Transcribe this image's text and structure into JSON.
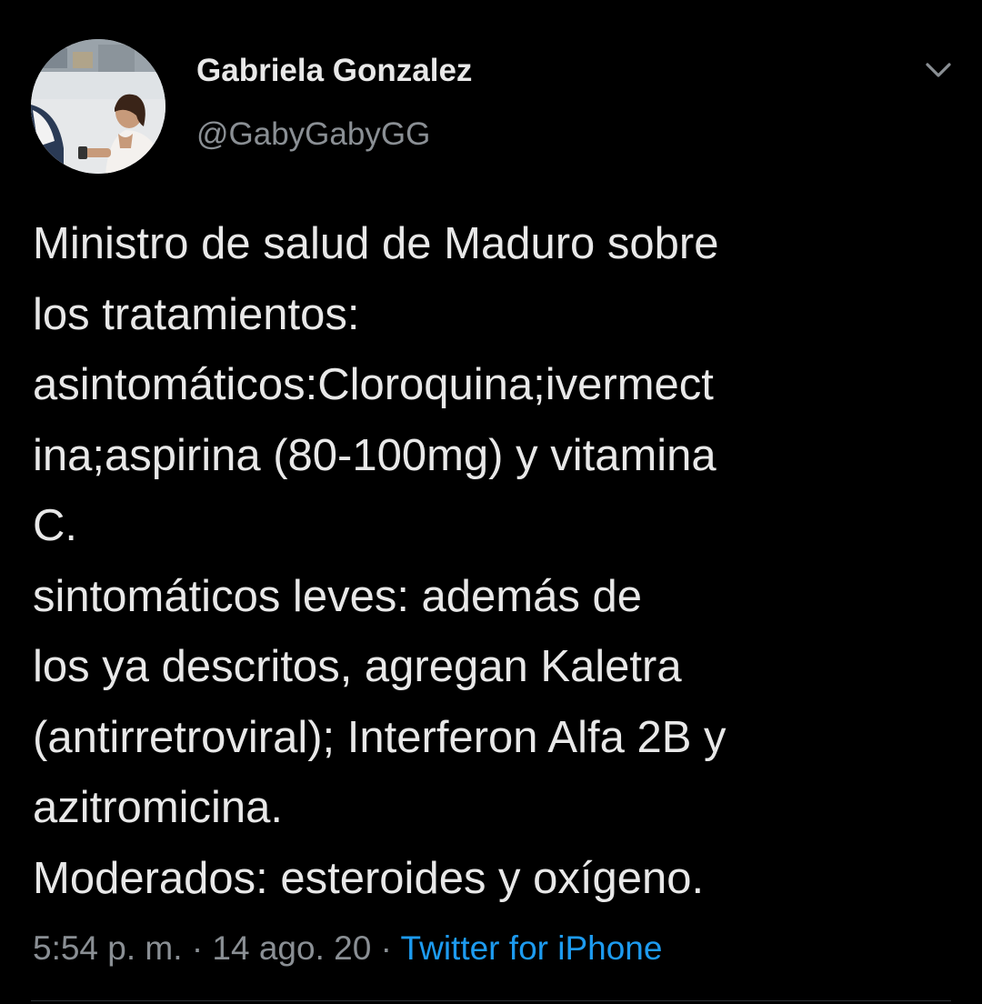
{
  "author": {
    "display_name": "Gabriela Gonzalez",
    "handle": "@GabyGabyGG",
    "avatar_icon": "profile-photo"
  },
  "tweet": {
    "lines": [
      "Ministro de salud de Maduro sobre",
      "los tratamientos:",
      "asintomáticos:Cloroquina;ivermect",
      "ina;aspirina (80-100mg) y vitamina",
      "C.",
      "sintomáticos leves: además de",
      "los ya descritos, agregan Kaletra",
      "(antirretroviral); Interferon Alfa 2B y",
      "azitromicina.",
      "Moderados: esteroides y oxígeno."
    ]
  },
  "meta": {
    "time": "5:54 p. m.",
    "separator": "·",
    "date": "14 ago. 20",
    "source": "Twitter for iPhone"
  },
  "menu": {
    "icon": "chevron-down-icon"
  },
  "colors": {
    "background": "#000000",
    "text": "#e8e8e8",
    "secondary": "#8a8f94",
    "link": "#1d9bf0"
  }
}
